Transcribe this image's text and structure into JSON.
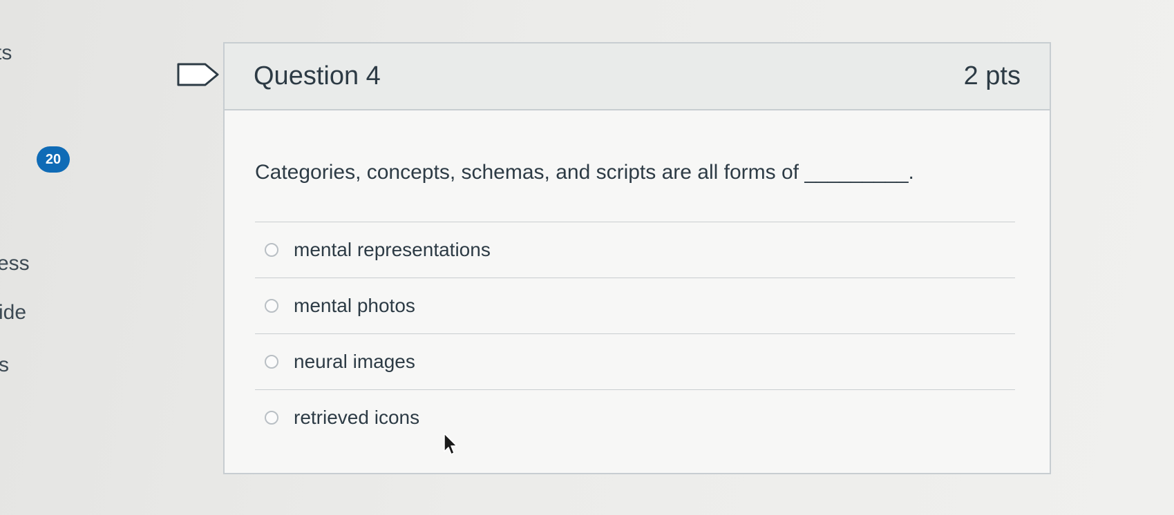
{
  "sidebar": {
    "fragments": [
      "ts",
      "ess",
      "ide",
      "s"
    ],
    "badge_count": "20"
  },
  "question": {
    "title": "Question 4",
    "points": "2 pts",
    "text": "Categories, concepts, schemas, and scripts are all forms of _________.",
    "answers": [
      {
        "label": "mental representations",
        "selected": false
      },
      {
        "label": "mental photos",
        "selected": false
      },
      {
        "label": "neural images",
        "selected": false
      },
      {
        "label": "retrieved icons",
        "selected": false
      }
    ]
  },
  "colors": {
    "badge": "#0f6bb6",
    "text": "#2d3b45",
    "border": "#c7cdd1"
  },
  "icons": {
    "flag": "flag-question-icon",
    "radio": "radio-button",
    "cursor": "mouse-pointer-icon"
  }
}
